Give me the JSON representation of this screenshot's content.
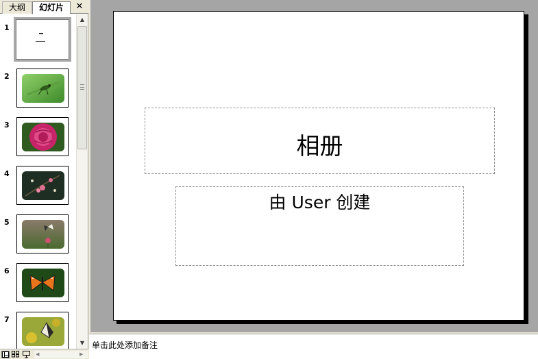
{
  "tabs": {
    "outline_label": "大纲",
    "slides_label": "幻灯片",
    "close_glyph": "✕"
  },
  "slides": [
    {
      "number": "1",
      "type": "title",
      "selected": true
    },
    {
      "number": "2",
      "type": "photo",
      "subject": "green grasshopper on leaf",
      "colors": [
        "#3f8a2a",
        "#8fd06a"
      ]
    },
    {
      "number": "3",
      "type": "photo",
      "subject": "pink rose",
      "colors": [
        "#c8246a",
        "#2f5a20"
      ]
    },
    {
      "number": "4",
      "type": "photo",
      "subject": "pink blossoms on dark background",
      "colors": [
        "#1f2e22",
        "#e07090"
      ]
    },
    {
      "number": "5",
      "type": "photo",
      "subject": "butterfly on flower",
      "colors": [
        "#5a6a40",
        "#d05070"
      ]
    },
    {
      "number": "6",
      "type": "photo",
      "subject": "orange monarch butterfly",
      "colors": [
        "#1f4a18",
        "#e8741c"
      ]
    },
    {
      "number": "7",
      "type": "photo",
      "subject": "butterfly on yellow flowers",
      "colors": [
        "#9aa83a",
        "#3c5a1c"
      ]
    }
  ],
  "slide": {
    "title": "相册",
    "subtitle": "由 User 创建"
  },
  "notes": {
    "placeholder": "单击此处添加备注"
  },
  "colors": {
    "workspace_bg": "#a5a5a5",
    "chrome_bg": "#ece9d8",
    "selection_border": "#a8a8a8"
  }
}
